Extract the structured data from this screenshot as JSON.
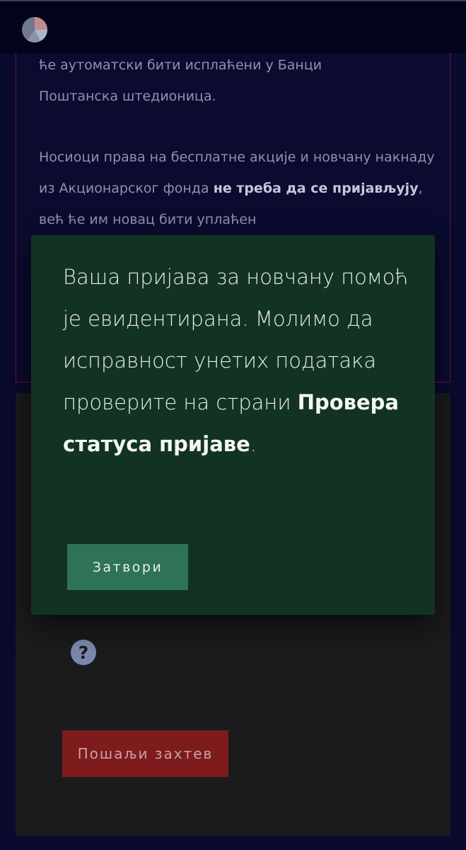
{
  "header": {
    "logo_icon": "pie-chart-icon"
  },
  "info": {
    "p1_line1": "ће аутоматски бити исплаћени у Банци",
    "p1_line2": "Поштанска штедионица.",
    "p2_start": "Носиоци права на бесплатне акције и новчану накнаду из Акционарског фонда ",
    "p2_bold": "не треба да се пријављују",
    "p2_end": ", већ ће им новац бити уплаћен"
  },
  "modal": {
    "message_start": "Ваша пријава за новчану помоћ је евидентирана. Молимо да исправност унетих података проверите на страни ",
    "message_link": "Провера статуса пријаве",
    "message_end": ".",
    "close_label": "Затвори"
  },
  "form": {
    "help_icon": "question-circle-icon",
    "help_glyph": "?",
    "submit_label": "Пошаљи захтев"
  },
  "colors": {
    "background": "#0a0a2e",
    "modal_background": "#123321",
    "close_button": "#2e7257",
    "submit_button": "#7e1b1d"
  }
}
